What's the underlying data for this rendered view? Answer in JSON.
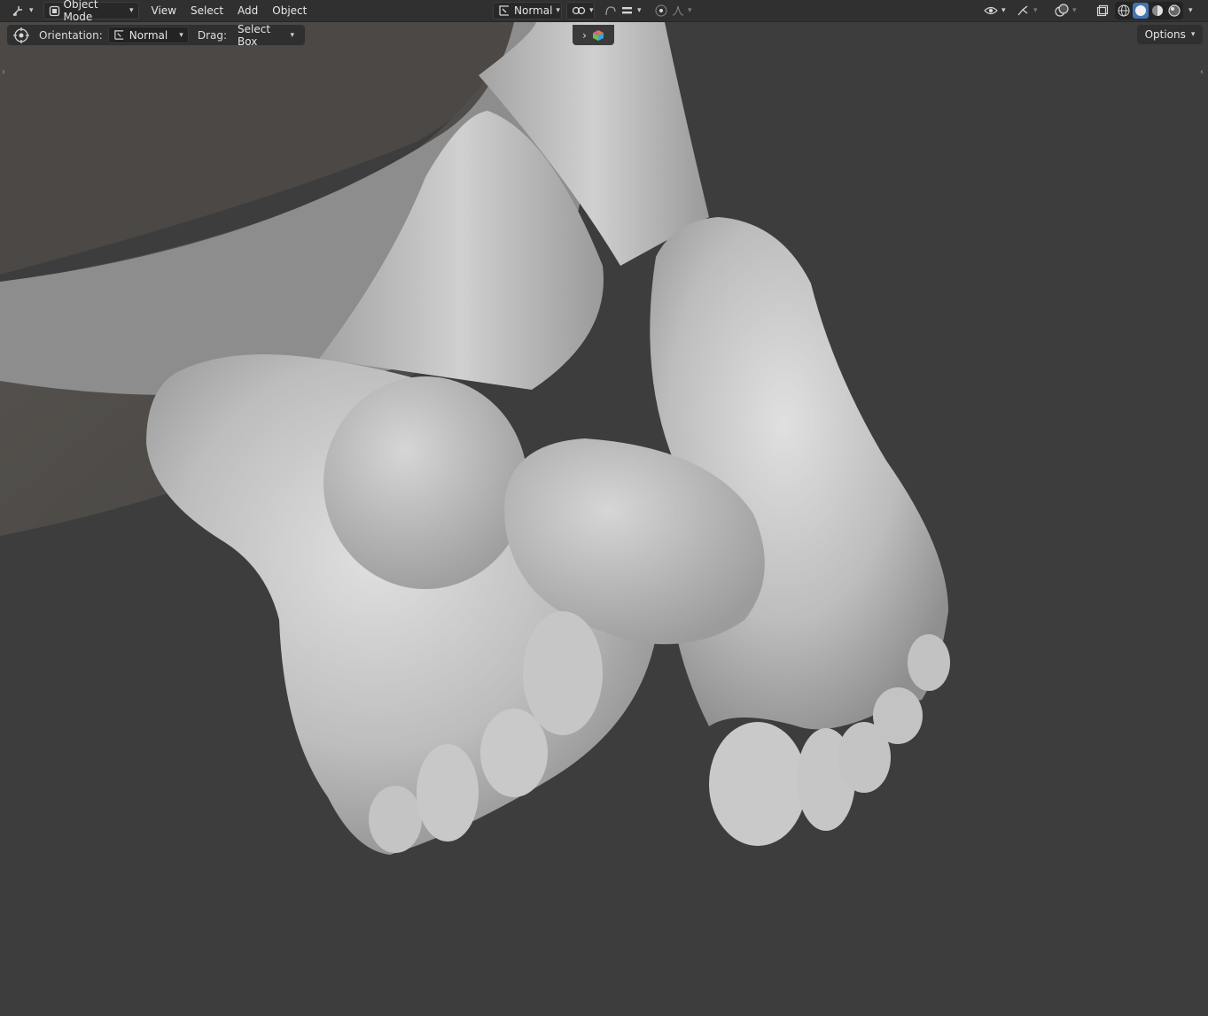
{
  "header": {
    "mode_label": "Object Mode",
    "menus": [
      "View",
      "Select",
      "Add",
      "Object"
    ],
    "transform_orientation": "Normal"
  },
  "tool_settings": {
    "orientation_label": "Orientation:",
    "orientation_value": "Normal",
    "drag_label": "Drag:",
    "drag_value": "Select Box"
  },
  "options_label": "Options",
  "icons": {
    "editor_type": "cursor-icon",
    "mode": "object-mode-icon",
    "transform": "transform-orientation-icon",
    "snap": "snap-icon",
    "proportional": "proportional-edit-icon",
    "visibility": "eye-icon",
    "gizmo": "gizmo-icon",
    "overlay": "overlay-icon",
    "xray": "xray-icon",
    "shading": [
      "wireframe-icon",
      "solid-icon",
      "material-preview-icon",
      "rendered-icon"
    ]
  },
  "colors": {
    "background": "#3d3d3d",
    "header": "#303030",
    "accent": "#4772b3",
    "mesh": "#c9c9c9"
  }
}
